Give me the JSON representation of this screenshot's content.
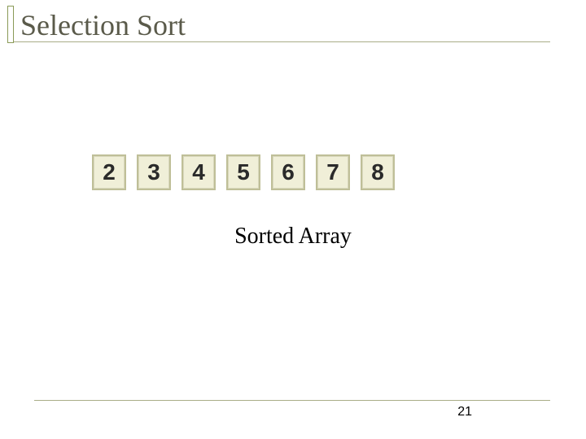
{
  "title": "Selection Sort",
  "array": {
    "values": [
      "2",
      "3",
      "4",
      "5",
      "6",
      "7",
      "8"
    ]
  },
  "caption": "Sorted Array",
  "page_number": "21"
}
